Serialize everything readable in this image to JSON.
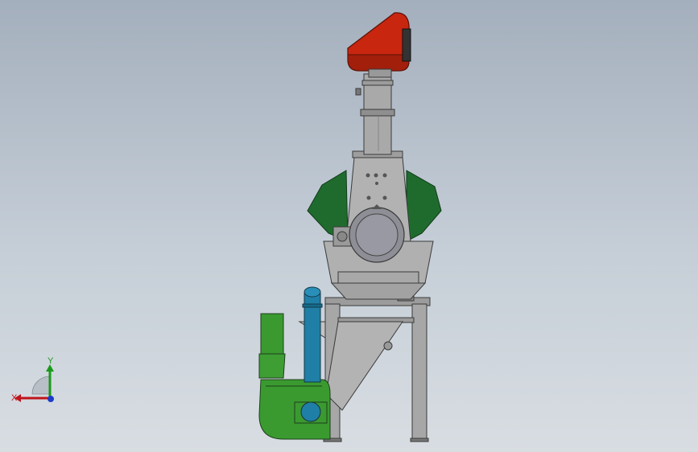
{
  "viewport": {
    "background_top": "#a4afbd",
    "background_bottom": "#d8dde2"
  },
  "model": {
    "colors": {
      "top_hood": "#c8260f",
      "body_steel": "#a9a9a9",
      "side_panels": "#1f6b2e",
      "motor_housing": "#8e8e96",
      "blue_pipe": "#1f7fa6",
      "green_fan": "#3a9a30",
      "outline": "#3a3a3a"
    }
  },
  "triad": {
    "x_label": "X",
    "y_label": "Y",
    "x_color": "#c0141c",
    "y_color": "#1a9a1a",
    "z_color": "#1c3cc8"
  }
}
